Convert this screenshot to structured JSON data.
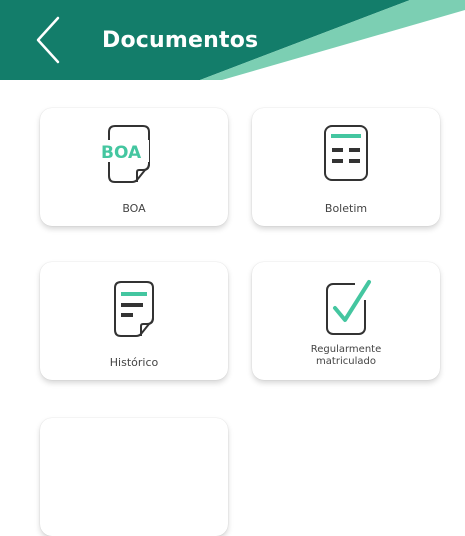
{
  "header": {
    "title": "Documentos",
    "colors": {
      "primary": "#137d6a",
      "light": "#7ccfb3"
    }
  },
  "cards": {
    "boa": {
      "label": "BOA",
      "icon_text": "BOA",
      "icon": "boa-document-icon"
    },
    "boletim": {
      "label": "Boletim",
      "icon": "report-card-icon"
    },
    "historico": {
      "label": "Histórico",
      "icon": "transcript-document-icon"
    },
    "regular": {
      "label_line1": "Regularmente",
      "label_line2": "matriculado",
      "icon": "checkmark-document-icon"
    }
  },
  "accent_color": "#44c6a0",
  "icon_stroke_color": "#333333"
}
